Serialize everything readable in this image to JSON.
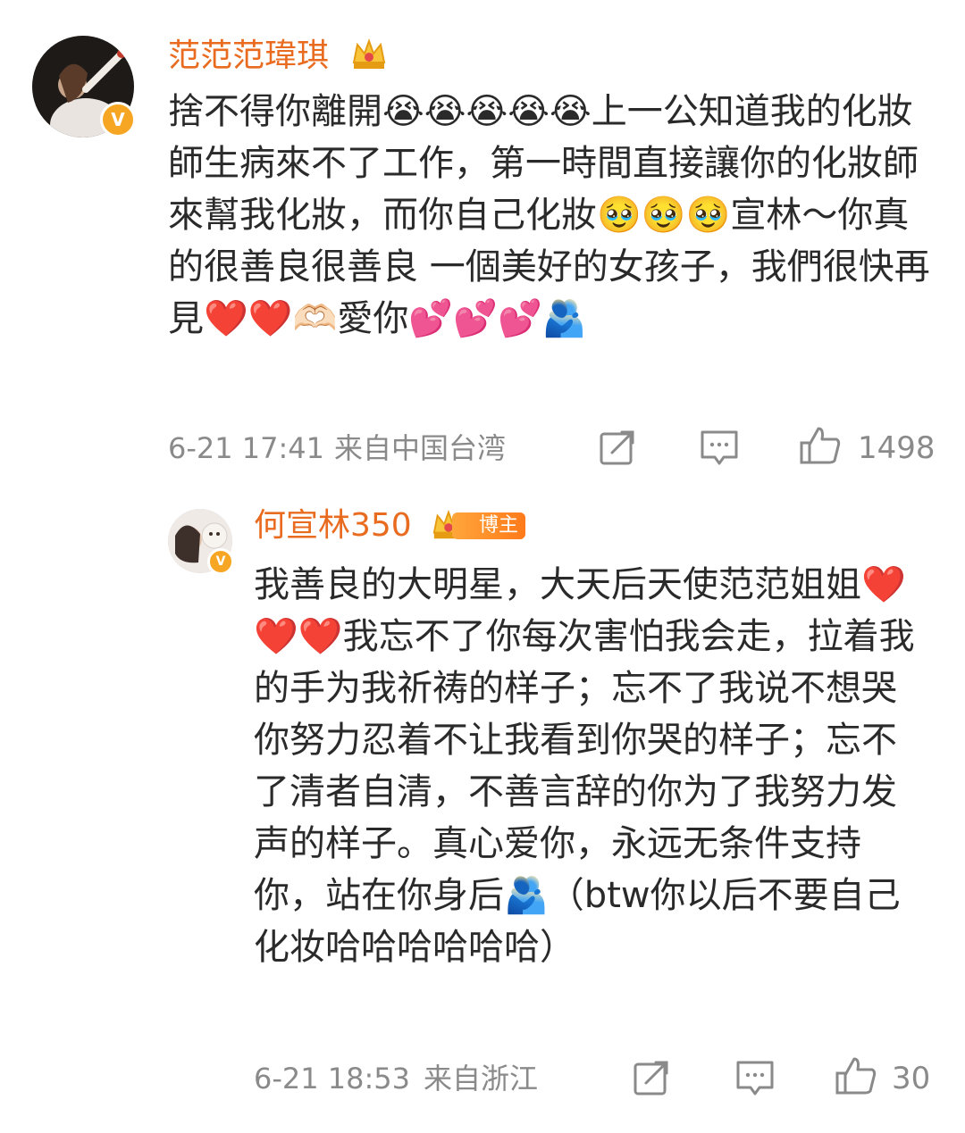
{
  "main_comment": {
    "username": "范范范瑋琪",
    "text": "捨不得你離開😭😭😭😭😭上一公知道我的化妝師生病來不了工作，第一時間直接讓你的化妝師來幫我化妝，而你自己化妝🥹🥹🥹宣林～你真的很善良很善良 一個美好的女孩子，我們很快再見❤️❤️🫶🏻愛你💕💕💕🫂",
    "time": "6-21 17:41",
    "location": "来自中国台湾",
    "likes": "1498",
    "verified_badge": "V"
  },
  "reply": {
    "username": "何宣林350",
    "tag": "博主",
    "text": "我善良的大明星，大天后天使范范姐姐❤️❤️❤️我忘不了你每次害怕我会走，拉着我的手为我祈祷的样子；忘不了我说不想哭你努力忍着不让我看到你哭的样子；忘不了清者自清，不善言辞的你为了我努力发声的样子。真心爱你，永远无条件支持你，站在你身后🫂（btw你以后不要自己化妆哈哈哈哈哈哈）",
    "time": "6-21 18:53",
    "location": "来自浙江",
    "likes": "30",
    "verified_badge": "V"
  },
  "icons": {
    "share": "share-icon",
    "comment": "comment-icon",
    "like": "thumbs-up-icon",
    "crown": "crown-icon"
  },
  "colors": {
    "username": "#e86b1f",
    "verified": "#f6a623",
    "meta": "#8a8a8a",
    "body": "#2a2a2a"
  }
}
